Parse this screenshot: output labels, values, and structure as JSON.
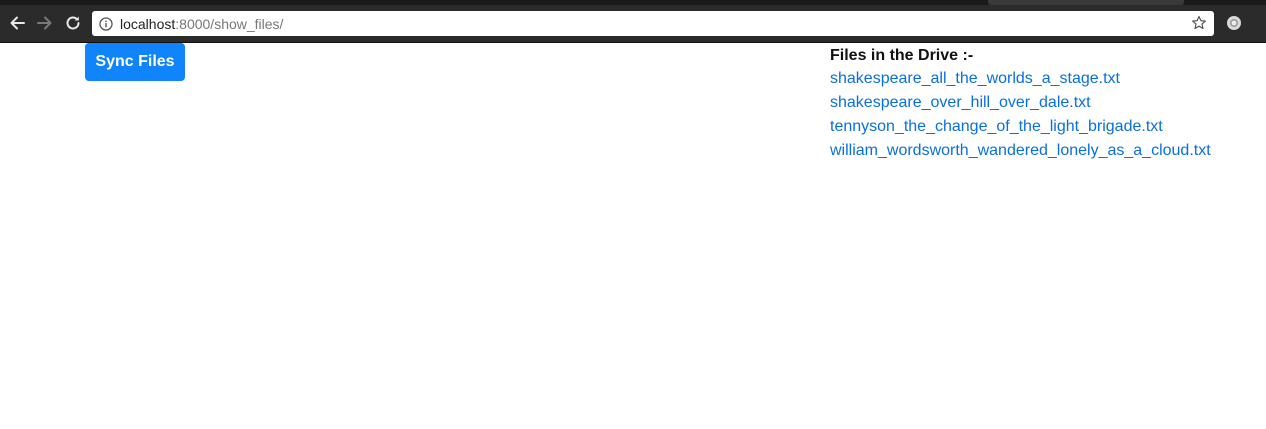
{
  "browser": {
    "url_host": "localhost",
    "url_rest": ":8000/show_files/",
    "icons": {
      "back": "arrow-left-icon",
      "forward": "arrow-right-icon",
      "reload": "reload-icon",
      "info": "info-icon",
      "bookmark": "star-icon",
      "extension": "extension-icon"
    }
  },
  "page": {
    "sync_button_label": "Sync Files",
    "files_heading": "Files in the Drive :-",
    "files": [
      "shakespeare_all_the_worlds_a_stage.txt",
      "shakespeare_over_hill_over_dale.txt",
      "tennyson_the_change_of_the_light_brigade.txt",
      "william_wordsworth_wandered_lonely_as_a_cloud.txt"
    ]
  },
  "colors": {
    "button_bg": "#0f84fb",
    "link": "#0a6fe0",
    "chrome_bg": "#2b2b2b"
  }
}
